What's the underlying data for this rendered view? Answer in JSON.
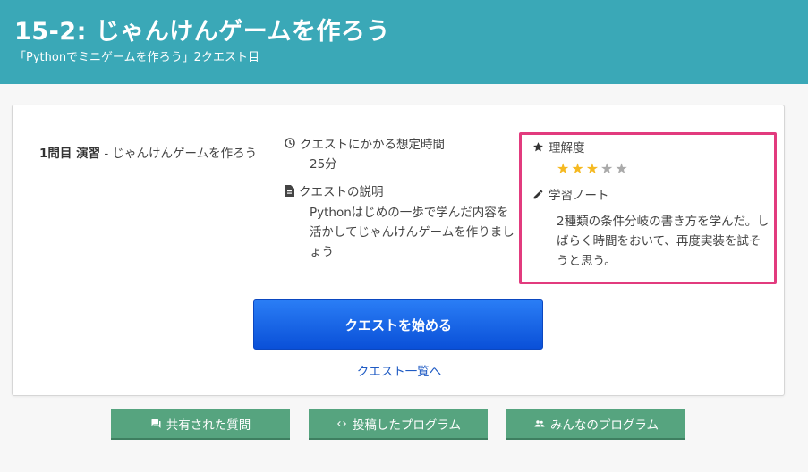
{
  "header": {
    "title": "15-2: じゃんけんゲームを作ろう",
    "subtitle": "「Pythonでミニゲームを作ろう」2クエスト目",
    "bg_color": "#3aa8b7"
  },
  "question": {
    "number": "1問目 演習",
    "label": " - じゃんけんゲームを作ろう"
  },
  "info": {
    "time_icon": "clock-icon",
    "time_label": "クエストにかかる想定時間",
    "time_value": "25分",
    "desc_icon": "document-icon",
    "desc_label": "クエストの説明",
    "desc_value": "Pythonはじめの一歩で学んだ内容を活かしてじゃんけんゲームを作りましょう"
  },
  "understanding": {
    "icon": "star-icon",
    "label": "理解度",
    "rating": 3,
    "max": 5,
    "star_on_color": "#f5b921",
    "star_off_color": "#aaaaaa",
    "note_icon": "pencil-icon",
    "note_label": "学習ノート",
    "note_text": "2種類の条件分岐の書き方を学んだ。しばらく時間をおいて、再度実装を試そうと思う。",
    "highlight_color": "#e23b7e"
  },
  "actions": {
    "start_label": "クエストを始める",
    "list_link": "クエスト一覧へ"
  },
  "footer_buttons": [
    {
      "icon": "chat-icon",
      "label": "共有された質問"
    },
    {
      "icon": "code-icon",
      "label": "投稿したプログラム"
    },
    {
      "icon": "people-icon",
      "label": "みんなのプログラム"
    }
  ]
}
